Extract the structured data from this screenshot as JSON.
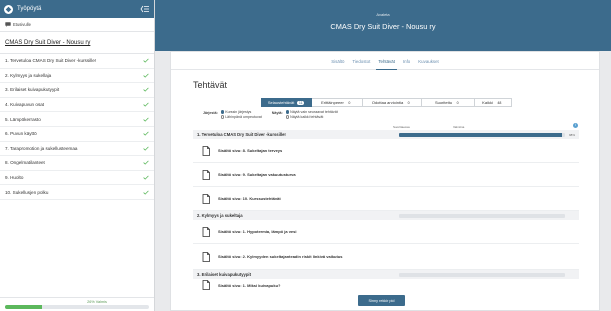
{
  "sidebar": {
    "workspace": "Työpöytä",
    "frontpage": "Etusivulle",
    "course_title": "CMAS Dry Suit Diver - Nousu ry",
    "items": [
      {
        "label": "1. Tervetuloa CMAS Dry Suit Diver -kurssille!"
      },
      {
        "label": "2. Kylmyys ja sukellaja"
      },
      {
        "label": "3. Erilaiset kuivapukutyypit"
      },
      {
        "label": "4. Kuivapuvun osat"
      },
      {
        "label": "5. Lämpökerrasto"
      },
      {
        "label": "6. Puvun käyttö"
      },
      {
        "label": "7. Tarapromotion ja sukellusteemaa"
      },
      {
        "label": "8. Ongelmatilanteet"
      },
      {
        "label": "9. Huolto"
      },
      {
        "label": "10. Sukellusjen polku"
      }
    ],
    "progress_label": "26% Valmis",
    "progress_fraction": 0.26
  },
  "header": {
    "section": "Avaleta",
    "course": "CMAS Dry Suit Diver - Nousu ry"
  },
  "tabs": [
    "Sisältö",
    "Tiedostot",
    "Tehtävät",
    "Info",
    "Kuvaukset"
  ],
  "active_tab": "Tehtävät",
  "main": {
    "title": "Tehtävät",
    "filters": [
      {
        "label": "Selaustehtävät",
        "count": "11",
        "active": true
      },
      {
        "label": "Erittäinpeeer",
        "count": "0",
        "active": false
      },
      {
        "label": "Odottaa arviointia",
        "count": "0",
        "active": false
      },
      {
        "label": "Suoritettu",
        "count": "0",
        "active": false
      },
      {
        "label": "Kaikki",
        "count": "48",
        "active": false
      }
    ],
    "sort_label": "Järjestä:",
    "sort_options": [
      "Kurssin järjestys",
      "Lähinpänä umpeutuvat"
    ],
    "show_label": "Näytä:",
    "show_options": [
      "Näytä vain seuraavat tehtävät",
      "Näytä kaikki tehtävät"
    ],
    "progress_headers": [
      "Suorittaessa",
      "Valmiina"
    ],
    "info_glyph": "i",
    "sections": [
      {
        "name": "1. Tervetuloa CMAS Dry Suit Diver -kurssille!",
        "fraction": 0.98,
        "pct": "98%",
        "tasks": [
          "Sisältö sivu: 8. Sukeltajan terveys",
          "Sisältö sivu: 9. Sukeltajan vakuutusturva",
          "Sisältö sivu: 10. Kurssustehtävät"
        ]
      },
      {
        "name": "2. Kylmyys ja sukeltaja",
        "fraction": 0,
        "pct": "",
        "tasks": [
          "Sisältö sivu: 1. Hypotermia, lämpö ja vesi",
          "Sisältö sivu: 2. Kylmyyden sukeltajanteadin riskit linkivä vaikutus"
        ]
      },
      {
        "name": "3. Erilaiset kuivapukutyypit",
        "fraction": 0,
        "pct": "",
        "tasks": [
          "Sisältö sivu: 1. Miksi kuivapuku?"
        ]
      }
    ],
    "bottom_button": "Sinny rekkir pid"
  },
  "colors": {
    "brand": "#3c6b8c",
    "success": "#5cb85c"
  }
}
